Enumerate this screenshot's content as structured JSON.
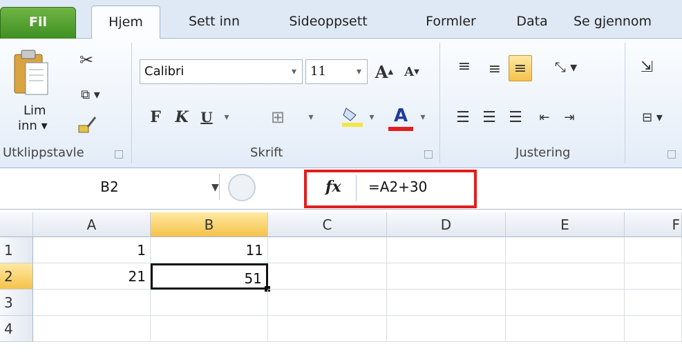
{
  "tabs": [
    "Fil",
    "Hjem",
    "Sett inn",
    "Sideoppsett",
    "Formler",
    "Data",
    "Se gjennom"
  ],
  "clipboard": {
    "paste_label_1": "Lim",
    "paste_label_2": "inn",
    "group_label": "Utklippstavle"
  },
  "font": {
    "name": "Calibri",
    "size": "11",
    "bold": "F",
    "italic": "K",
    "underline": "U",
    "group_label": "Skrift"
  },
  "alignment": {
    "group_label": "Justering"
  },
  "formula_bar": {
    "name_box": "B2",
    "fx": "fx",
    "formula": "=A2+30"
  },
  "grid": {
    "columns": [
      "A",
      "B",
      "C",
      "D",
      "E",
      "F"
    ],
    "rows": [
      "1",
      "2",
      "3",
      "4"
    ],
    "cells": {
      "A1": "1",
      "B1": "11",
      "A2": "21",
      "B2": "51"
    }
  },
  "colors": {
    "highlight_box": "#e11d1d",
    "file_tab": "#3f8f23",
    "selection_header": "#f5c24a"
  }
}
